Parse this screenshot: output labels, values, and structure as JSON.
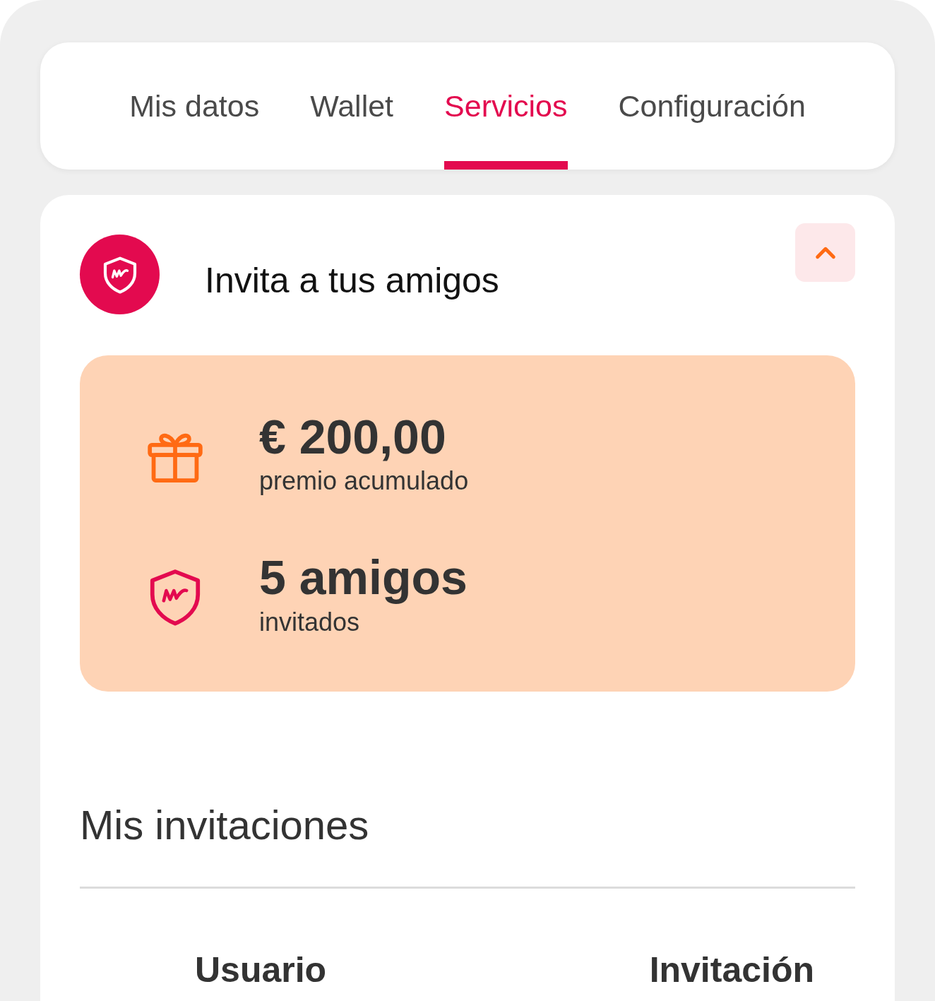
{
  "tabs": [
    {
      "label": "Mis datos",
      "selected": false
    },
    {
      "label": "Wallet",
      "selected": false
    },
    {
      "label": "Servicios",
      "selected": true
    },
    {
      "label": "Configuración",
      "selected": false
    }
  ],
  "section": {
    "title": "Invita a tus amigos",
    "expanded": true
  },
  "stats": [
    {
      "kind": "gift",
      "value": "€ 200,00",
      "caption": "premio acumulado"
    },
    {
      "kind": "shield",
      "value": "5 amigos",
      "caption": "invitados"
    }
  ],
  "invitations": {
    "title": "Mis invitaciones",
    "columns": [
      "Usuario",
      "Invitación"
    ]
  }
}
